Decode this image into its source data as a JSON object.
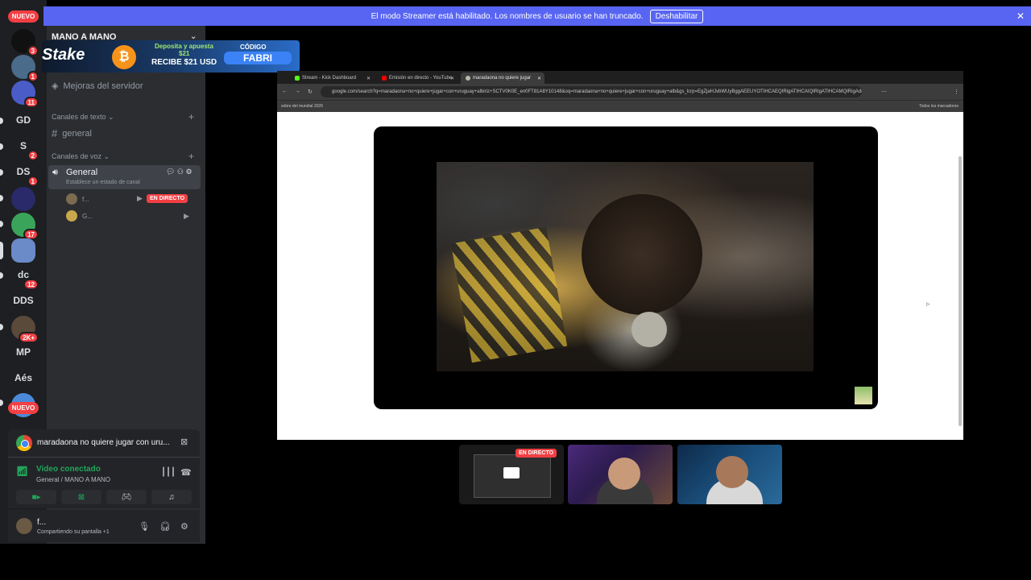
{
  "rail": {
    "nuevo_top": "NUEVO",
    "nuevo_bottom": "NUEVO",
    "servers": [
      {
        "label": "",
        "badge": "3"
      },
      {
        "label": "",
        "badge": "1"
      },
      {
        "label": "",
        "badge": "11"
      },
      {
        "label": "GD",
        "badge": ""
      },
      {
        "label": "S",
        "badge": "2"
      },
      {
        "label": "DS",
        "badge": "1"
      },
      {
        "label": "",
        "badge": ""
      },
      {
        "label": "",
        "badge": "17"
      },
      {
        "label": "",
        "badge": ""
      },
      {
        "label": "dc",
        "badge": "12"
      },
      {
        "label": "DDS",
        "badge": ""
      },
      {
        "label": "",
        "badge": "2K+"
      },
      {
        "label": "MP",
        "badge": ""
      },
      {
        "label": "Aés",
        "badge": ""
      }
    ]
  },
  "banner": {
    "text": "El modo Streamer está habilitado. Los nombres de usuario se han truncado.",
    "button": "Deshabilitar",
    "close": "✕"
  },
  "sidebar": {
    "server_name": "MANO A MANO",
    "boost": "Mejoras del servidor",
    "text_category": "Canales de texto",
    "text_channel": "general",
    "voice_category": "Canales de voz",
    "voice_channel": "General",
    "voice_status": "Establece un estado de canal",
    "users": [
      {
        "name": "f...",
        "live": "EN DIRECTO"
      },
      {
        "name": "G...",
        "live": ""
      }
    ]
  },
  "ad": {
    "logo": "Stake",
    "line1": "Deposita y apuesta",
    "line2": "$21",
    "line3": "RECIBE $21 USD",
    "code_label": "CÓDIGO",
    "code": "FABRI"
  },
  "activity": {
    "title": "maradaona no quiere jugar con uru..."
  },
  "voice_panel": {
    "status": "Video conectado",
    "location": "General / MANO A MANO"
  },
  "user_panel": {
    "name": "f...",
    "status": "Compartiendo su pantalla",
    "extra": "+1"
  },
  "browser": {
    "tabs": [
      {
        "title": "Stream - Kick Dashboard",
        "color": "#53fc18"
      },
      {
        "title": "Emisión en directo - YouTube",
        "color": "#ff0000"
      },
      {
        "title": "maradaona no quiere jugar",
        "color": "#bdb9a8"
      }
    ],
    "url": "google.com/search?q=maradaona+no+quiere+jugar+con+uruguay+albiriz+SCTV0K0E_en0FT81A8Y10148&oq=maradaona+no+quiere+jugar+con+uruguay+alb&gs_lcrp=EgZjaHJvbWUyBggAEEUYOTIHCAEQIRigATIHCAIQIRigATIHCAMQIRigAdIB",
    "bookmark": "sobre del mundial 2026",
    "all_bookmarks": "Todos los marcadores"
  },
  "tiles": {
    "live_label": "EN DIRECTO"
  }
}
